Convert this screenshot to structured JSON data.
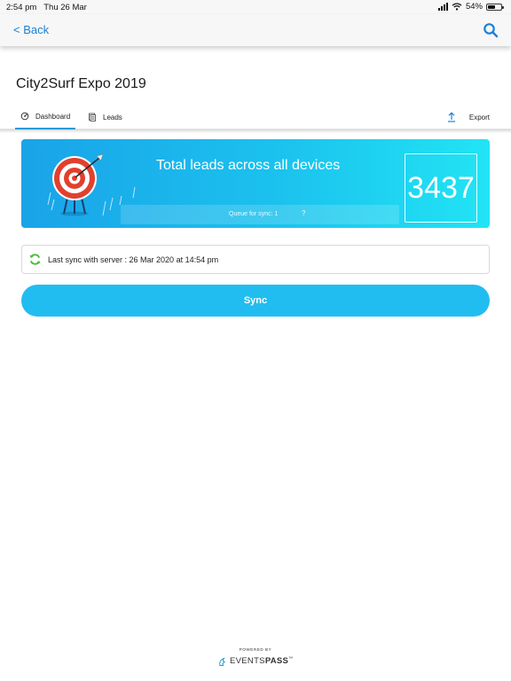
{
  "status_bar": {
    "time": "2:54 pm",
    "date": "Thu 26 Mar",
    "battery": "54%",
    "battery_level": 0.54
  },
  "nav": {
    "back_label": "< Back"
  },
  "page": {
    "title": "City2Surf Expo 2019"
  },
  "tabs": [
    {
      "label": "Dashboard",
      "icon": "dashboard-gauge-icon",
      "selected": true
    },
    {
      "label": "Leads",
      "icon": "leads-list-icon",
      "selected": false
    }
  ],
  "export": {
    "label": "Export",
    "icon": "upload-arrow-icon"
  },
  "leads_card": {
    "title": "Total leads across all devices",
    "count": "3437",
    "queue_label": "Queue for sync: 1",
    "queue_help": "?"
  },
  "sync": {
    "last_sync_text": "Last sync with server : 26 Mar 2020 at 14:54 pm",
    "button_label": "Sync"
  },
  "footer": {
    "powered_by": "POWERED BY",
    "brand_prefix": "EVENTS",
    "brand_suffix": "PASS",
    "trademark": "™"
  },
  "colors": {
    "accent": "#1a80d8",
    "card_start": "#1aa3e8",
    "card_end": "#22e4f4",
    "sync_button": "#22bdf0",
    "sync_icon": "#4cbb3a"
  }
}
